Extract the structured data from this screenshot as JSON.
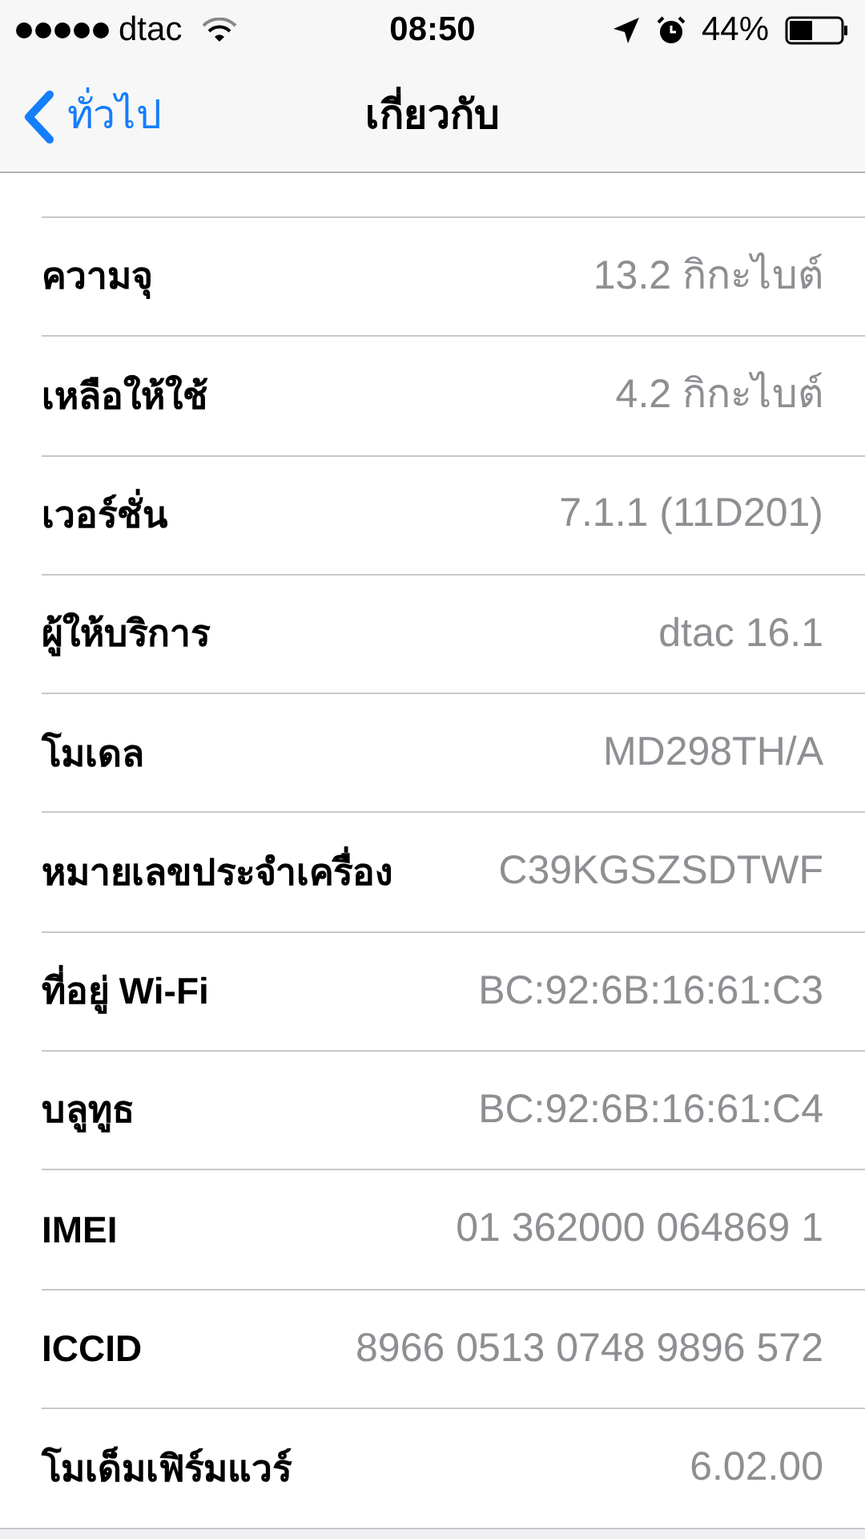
{
  "status_bar": {
    "carrier": "dtac",
    "time": "08:50",
    "battery": "44%"
  },
  "nav": {
    "back": "ทั่วไป",
    "title": "เกี่ยวกับ"
  },
  "rows": [
    {
      "label": "ความจุ",
      "value": "13.2 กิกะไบต์"
    },
    {
      "label": "เหลือให้ใช้",
      "value": "4.2 กิกะไบต์"
    },
    {
      "label": "เวอร์ชั่น",
      "value": "7.1.1 (11D201)"
    },
    {
      "label": "ผู้ให้บริการ",
      "value": "dtac 16.1"
    },
    {
      "label": "โมเดล",
      "value": "MD298TH/A"
    },
    {
      "label": "หมายเลขประจำเครื่อง",
      "value": "C39KGSZSDTWF"
    },
    {
      "label": "ที่อยู่ Wi-Fi",
      "value": "BC:92:6B:16:61:C3"
    },
    {
      "label": "บลูทูธ",
      "value": "BC:92:6B:16:61:C4"
    },
    {
      "label": "IMEI",
      "value": "01 362000 064869 1"
    },
    {
      "label": "ICCID",
      "value": "8966 0513 0748 9896 572"
    },
    {
      "label": "โมเด็มเฟิร์มแวร์",
      "value": "6.02.00"
    }
  ]
}
